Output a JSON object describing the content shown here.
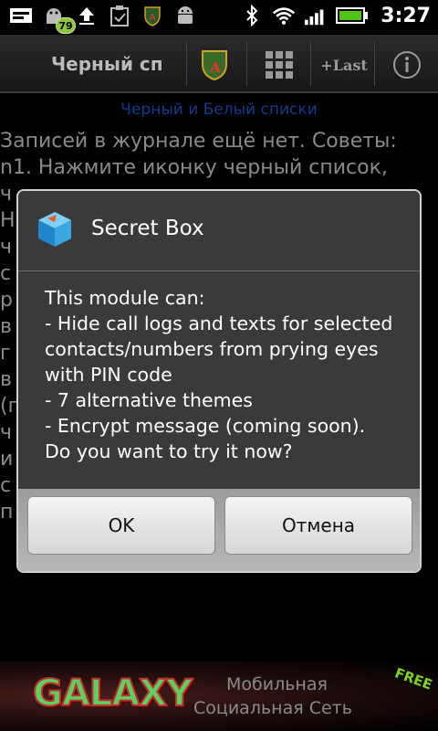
{
  "status_bar": {
    "notification_badge": "79",
    "time": "3:27"
  },
  "action_bar": {
    "title": "Черный сп",
    "last_label": "+Last"
  },
  "background": {
    "subheader": "Черный и Белый списки",
    "lines": [
      "Записей в журнале ещё нет. Советы:",
      "n1. Нажмите иконку черный список,",
      "ч",
      "Н",
      "ч",
      "с",
      "р",
      "в",
      "г",
      "в",
      "(п",
      "ч",
      "и",
      "с",
      "п"
    ]
  },
  "dialog": {
    "title": "Secret Box",
    "message": "This module can:\n- Hide call logs and texts for selected contacts/numbers from prying eyes with PIN code\n- 7 alternative themes\n- Encrypt message (coming soon).\nDo you want to try it now?",
    "ok_label": "OK",
    "cancel_label": "Отмена"
  },
  "banner": {
    "brand": "GALAXY",
    "free": "FREE",
    "line1": "Мобильная",
    "line2": "Социальная Сеть"
  },
  "colors": {
    "subheader": "#123a8a",
    "battery": "#4fc414",
    "badge": "#8dc63f"
  }
}
